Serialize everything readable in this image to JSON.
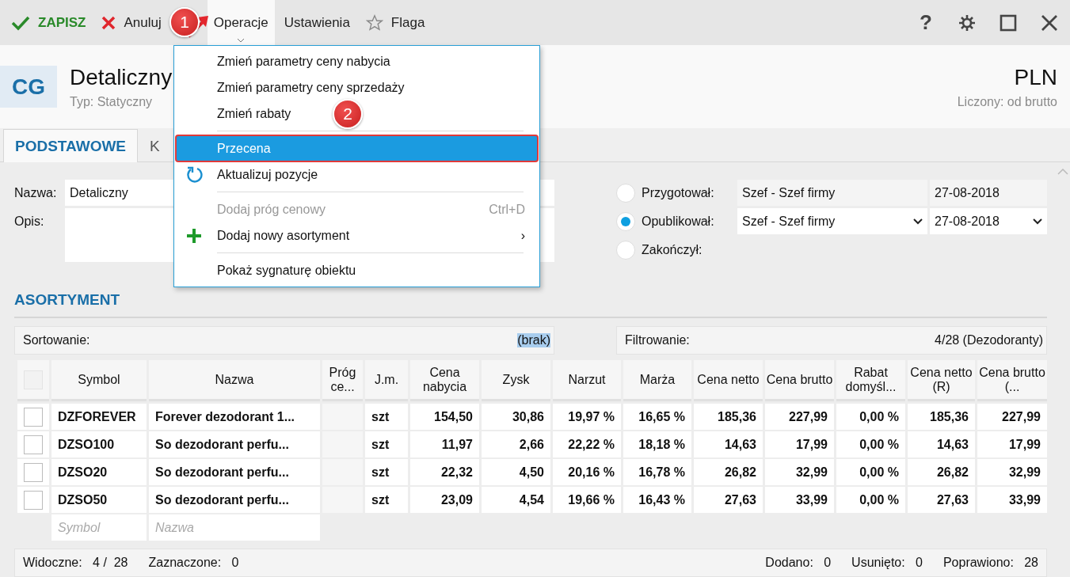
{
  "toolbar": {
    "buttons": [
      {
        "label": "ZAPISZ",
        "kind": "save",
        "selected": false
      },
      {
        "label": "Anuluj",
        "kind": "cancel",
        "selected": false
      },
      {
        "label": "Operacje",
        "kind": "menu",
        "selected": true
      },
      {
        "label": "Ustawienia",
        "kind": "plain",
        "selected": false
      },
      {
        "label": "Flaga",
        "kind": "flag",
        "selected": false
      }
    ],
    "window_controls": [
      {
        "kind": "help",
        "label": "?"
      },
      {
        "kind": "settings"
      },
      {
        "kind": "maximize"
      },
      {
        "kind": "close"
      }
    ]
  },
  "header": {
    "badge": "CG",
    "title": "Detaliczny",
    "subtitle": "Typ: Statyczny",
    "currency": "PLN",
    "currency_note": "Liczony: od brutto"
  },
  "tabs": [
    {
      "label": "PODSTAWOWE",
      "selected": true
    },
    {
      "label": "K",
      "selected": false
    }
  ],
  "form": {
    "name_label": "Nazwa:",
    "name_value": "Detaliczny",
    "description_label": "Opis:"
  },
  "approvals": [
    {
      "label": "Przygotował:",
      "selected": false,
      "person": "Szef - Szef firmy",
      "date": "27-08-2018",
      "dropdown": false
    },
    {
      "label": "Opublikował:",
      "selected": true,
      "person": "Szef - Szef firmy",
      "date": "27-08-2018",
      "dropdown": true
    },
    {
      "label": "Zakończył:",
      "selected": false
    }
  ],
  "section_title": "ASORTYMENT",
  "sorting": {
    "label": "Sortowanie:",
    "value": "(brak)",
    "highlighted": true
  },
  "filtering": {
    "label": "Filtrowanie:",
    "value": "4/28 (Dezodoranty)"
  },
  "table": {
    "select_all": {
      "checked": false,
      "disabled": true
    },
    "columns": [
      {
        "label": "Symbol",
        "kind": "text"
      },
      {
        "label": "Nazwa",
        "kind": "text"
      },
      {
        "label": "Próg ce...",
        "kind": "text"
      },
      {
        "label": "J.m.",
        "kind": "text"
      },
      {
        "label": "Cena nabycia",
        "kind": "number"
      },
      {
        "label": "Zysk",
        "kind": "number"
      },
      {
        "label": "Narzut",
        "kind": "number"
      },
      {
        "label": "Marża",
        "kind": "number"
      },
      {
        "label": "Cena netto",
        "kind": "number"
      },
      {
        "label": "Cena brutto",
        "kind": "number"
      },
      {
        "label": "Rabat domyśl...",
        "kind": "number"
      },
      {
        "label": "Cena netto (R)",
        "kind": "number"
      },
      {
        "label": "Cena brutto (...",
        "kind": "number"
      }
    ],
    "rows": [
      {
        "checked": false,
        "cells": [
          "DZFOREVER",
          "Forever dezodorant 1...",
          "",
          "szt",
          "154,50",
          "30,86",
          "19,97 %",
          "16,65 %",
          "185,36",
          "227,99",
          "0,00 %",
          "185,36",
          "227,99"
        ]
      },
      {
        "checked": false,
        "cells": [
          "DZSO100",
          "So dezodorant perfu...",
          "",
          "szt",
          "11,97",
          "2,66",
          "22,22 %",
          "18,18 %",
          "14,63",
          "17,99",
          "0,00 %",
          "14,63",
          "17,99"
        ]
      },
      {
        "checked": false,
        "cells": [
          "DZSO20",
          "So dezodorant perfu...",
          "",
          "szt",
          "22,32",
          "4,50",
          "20,16 %",
          "16,78 %",
          "26,82",
          "32,99",
          "0,00 %",
          "26,82",
          "32,99"
        ]
      },
      {
        "checked": false,
        "cells": [
          "DZSO50",
          "So dezodorant perfu...",
          "",
          "szt",
          "23,09",
          "4,54",
          "19,66 %",
          "16,43 %",
          "27,63",
          "33,99",
          "0,00 %",
          "27,63",
          "33,99"
        ]
      }
    ],
    "new_row": {
      "symbol_placeholder": "Symbol",
      "name_placeholder": "Nazwa"
    }
  },
  "footer": {
    "left": [
      {
        "label": "Widoczne:",
        "value": "4 /  28"
      },
      {
        "label": "Zaznaczone:",
        "value": "0"
      }
    ],
    "right": [
      {
        "label": "Dodano:",
        "value": "0"
      },
      {
        "label": "Usunięto:",
        "value": "0"
      },
      {
        "label": "Poprawiono:",
        "value": "28"
      }
    ]
  },
  "menu": {
    "groups": [
      [
        {
          "label": "Zmień parametry ceny nabycia",
          "kind": "command",
          "disabled": false,
          "selected": false
        },
        {
          "label": "Zmień parametry ceny sprzedaży",
          "kind": "command",
          "disabled": false,
          "selected": false
        },
        {
          "label": "Zmień rabaty",
          "kind": "command",
          "disabled": false,
          "selected": false
        }
      ],
      [
        {
          "label": "Przecena",
          "kind": "command",
          "disabled": false,
          "selected": true
        },
        {
          "label": "Aktualizuj pozycje",
          "kind": "refresh_command",
          "disabled": false,
          "selected": false
        }
      ],
      [
        {
          "label": "Dodaj próg cenowy",
          "kind": "command",
          "disabled": true,
          "selected": false,
          "shortcut": "Ctrl+D"
        },
        {
          "label": "Dodaj nowy asortyment",
          "kind": "add_command",
          "disabled": false,
          "selected": false,
          "submenu": "›"
        }
      ],
      [
        {
          "label": "Pokaż sygnaturę obiektu",
          "kind": "command",
          "disabled": false,
          "selected": false
        }
      ]
    ]
  },
  "annotations": [
    {
      "label": "1",
      "pointer": true
    },
    {
      "label": "2",
      "pointer": false
    }
  ]
}
